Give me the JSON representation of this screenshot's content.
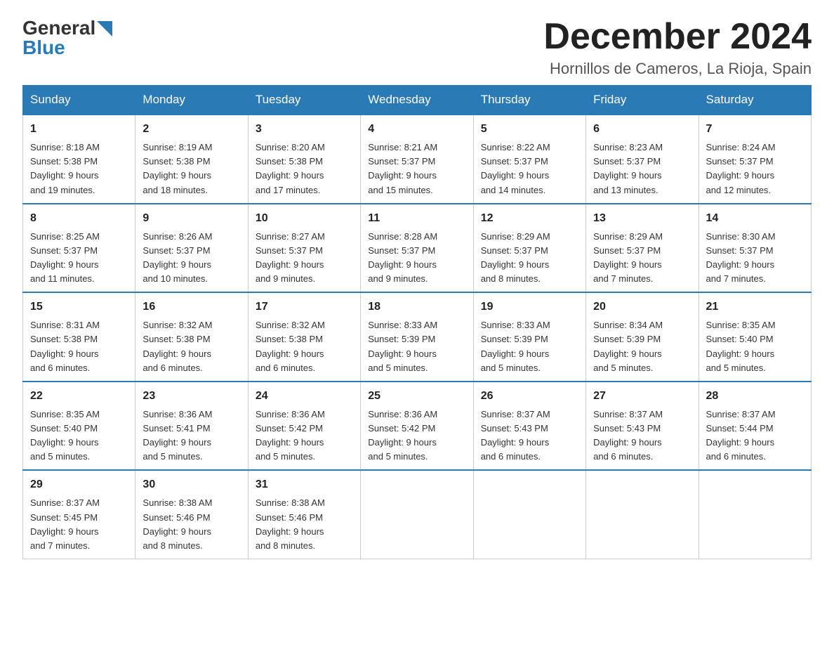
{
  "header": {
    "logo_general": "General",
    "logo_blue": "Blue",
    "month_title": "December 2024",
    "location": "Hornillos de Cameros, La Rioja, Spain"
  },
  "days_of_week": [
    "Sunday",
    "Monday",
    "Tuesday",
    "Wednesday",
    "Thursday",
    "Friday",
    "Saturday"
  ],
  "weeks": [
    [
      {
        "day": "1",
        "sunrise": "8:18 AM",
        "sunset": "5:38 PM",
        "daylight": "9 hours and 19 minutes."
      },
      {
        "day": "2",
        "sunrise": "8:19 AM",
        "sunset": "5:38 PM",
        "daylight": "9 hours and 18 minutes."
      },
      {
        "day": "3",
        "sunrise": "8:20 AM",
        "sunset": "5:38 PM",
        "daylight": "9 hours and 17 minutes."
      },
      {
        "day": "4",
        "sunrise": "8:21 AM",
        "sunset": "5:37 PM",
        "daylight": "9 hours and 15 minutes."
      },
      {
        "day": "5",
        "sunrise": "8:22 AM",
        "sunset": "5:37 PM",
        "daylight": "9 hours and 14 minutes."
      },
      {
        "day": "6",
        "sunrise": "8:23 AM",
        "sunset": "5:37 PM",
        "daylight": "9 hours and 13 minutes."
      },
      {
        "day": "7",
        "sunrise": "8:24 AM",
        "sunset": "5:37 PM",
        "daylight": "9 hours and 12 minutes."
      }
    ],
    [
      {
        "day": "8",
        "sunrise": "8:25 AM",
        "sunset": "5:37 PM",
        "daylight": "9 hours and 11 minutes."
      },
      {
        "day": "9",
        "sunrise": "8:26 AM",
        "sunset": "5:37 PM",
        "daylight": "9 hours and 10 minutes."
      },
      {
        "day": "10",
        "sunrise": "8:27 AM",
        "sunset": "5:37 PM",
        "daylight": "9 hours and 9 minutes."
      },
      {
        "day": "11",
        "sunrise": "8:28 AM",
        "sunset": "5:37 PM",
        "daylight": "9 hours and 9 minutes."
      },
      {
        "day": "12",
        "sunrise": "8:29 AM",
        "sunset": "5:37 PM",
        "daylight": "9 hours and 8 minutes."
      },
      {
        "day": "13",
        "sunrise": "8:29 AM",
        "sunset": "5:37 PM",
        "daylight": "9 hours and 7 minutes."
      },
      {
        "day": "14",
        "sunrise": "8:30 AM",
        "sunset": "5:37 PM",
        "daylight": "9 hours and 7 minutes."
      }
    ],
    [
      {
        "day": "15",
        "sunrise": "8:31 AM",
        "sunset": "5:38 PM",
        "daylight": "9 hours and 6 minutes."
      },
      {
        "day": "16",
        "sunrise": "8:32 AM",
        "sunset": "5:38 PM",
        "daylight": "9 hours and 6 minutes."
      },
      {
        "day": "17",
        "sunrise": "8:32 AM",
        "sunset": "5:38 PM",
        "daylight": "9 hours and 6 minutes."
      },
      {
        "day": "18",
        "sunrise": "8:33 AM",
        "sunset": "5:39 PM",
        "daylight": "9 hours and 5 minutes."
      },
      {
        "day": "19",
        "sunrise": "8:33 AM",
        "sunset": "5:39 PM",
        "daylight": "9 hours and 5 minutes."
      },
      {
        "day": "20",
        "sunrise": "8:34 AM",
        "sunset": "5:39 PM",
        "daylight": "9 hours and 5 minutes."
      },
      {
        "day": "21",
        "sunrise": "8:35 AM",
        "sunset": "5:40 PM",
        "daylight": "9 hours and 5 minutes."
      }
    ],
    [
      {
        "day": "22",
        "sunrise": "8:35 AM",
        "sunset": "5:40 PM",
        "daylight": "9 hours and 5 minutes."
      },
      {
        "day": "23",
        "sunrise": "8:36 AM",
        "sunset": "5:41 PM",
        "daylight": "9 hours and 5 minutes."
      },
      {
        "day": "24",
        "sunrise": "8:36 AM",
        "sunset": "5:42 PM",
        "daylight": "9 hours and 5 minutes."
      },
      {
        "day": "25",
        "sunrise": "8:36 AM",
        "sunset": "5:42 PM",
        "daylight": "9 hours and 5 minutes."
      },
      {
        "day": "26",
        "sunrise": "8:37 AM",
        "sunset": "5:43 PM",
        "daylight": "9 hours and 6 minutes."
      },
      {
        "day": "27",
        "sunrise": "8:37 AM",
        "sunset": "5:43 PM",
        "daylight": "9 hours and 6 minutes."
      },
      {
        "day": "28",
        "sunrise": "8:37 AM",
        "sunset": "5:44 PM",
        "daylight": "9 hours and 6 minutes."
      }
    ],
    [
      {
        "day": "29",
        "sunrise": "8:37 AM",
        "sunset": "5:45 PM",
        "daylight": "9 hours and 7 minutes."
      },
      {
        "day": "30",
        "sunrise": "8:38 AM",
        "sunset": "5:46 PM",
        "daylight": "9 hours and 8 minutes."
      },
      {
        "day": "31",
        "sunrise": "8:38 AM",
        "sunset": "5:46 PM",
        "daylight": "9 hours and 8 minutes."
      },
      null,
      null,
      null,
      null
    ]
  ],
  "labels": {
    "sunrise": "Sunrise:",
    "sunset": "Sunset:",
    "daylight": "Daylight:"
  }
}
